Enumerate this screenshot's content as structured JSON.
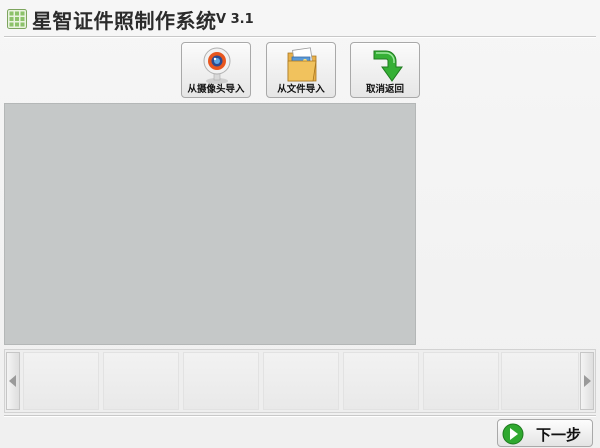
{
  "app": {
    "title": "星智证件照制作系统",
    "version": "V 3.1"
  },
  "toolbar": {
    "camera_import_label": "从摄像头导入",
    "file_import_label": "从文件导入",
    "cancel_return_label": "取消返回"
  },
  "footer": {
    "next_label": "下一步"
  },
  "icons": {
    "app": "grid-logo-icon",
    "camera": "webcam-icon",
    "file": "folder-image-icon",
    "cancel": "green-arrow-return-icon",
    "next": "green-arrow-right-icon",
    "strip_left": "triangle-left-icon",
    "strip_right": "triangle-right-icon"
  },
  "colors": {
    "preview_bg": "#c5c8c8",
    "accent_green": "#2fa82f",
    "camera_orange": "#e8561e"
  }
}
